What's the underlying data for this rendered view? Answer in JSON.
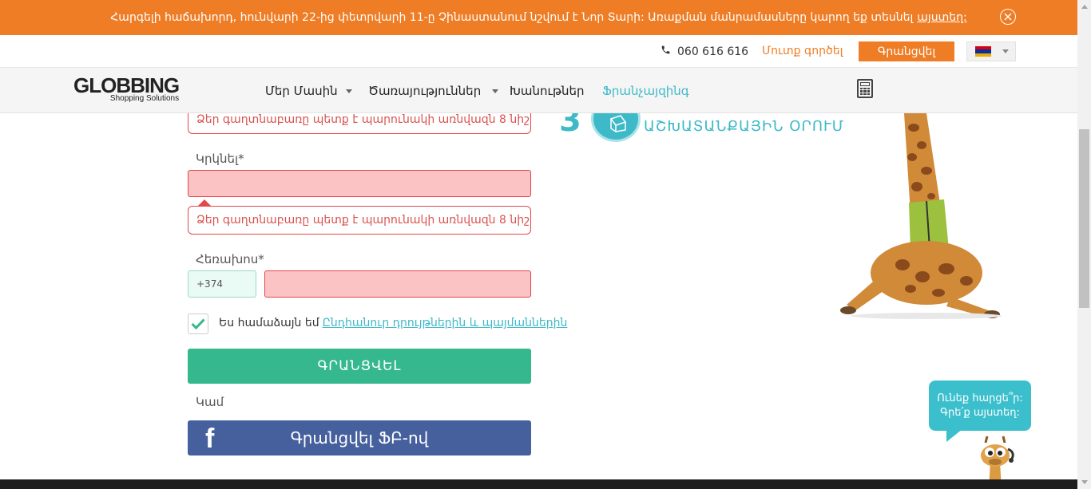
{
  "announcement": {
    "text": "Հարգելի հաճախորդ, հունվարի 22-ից փետրվարի 11-ը Չինաստանում նշվում է Նոր Տարի: Առաքման մանրամասները կարող եք տեսնել",
    "link": "այստեղ:"
  },
  "topbar": {
    "phone": "060 616 616",
    "login": "Մուտք գործել",
    "register": "Գրանցվել",
    "language_flag": [
      "#d90012",
      "#0033a0",
      "#f2a800"
    ]
  },
  "nav": {
    "logo_brand": "GLOBBING",
    "logo_sub": "Shopping Solutions",
    "items": [
      {
        "label": "Մեր Մասին",
        "has_dropdown": true
      },
      {
        "label": "Ծառայություններ",
        "has_dropdown": true
      },
      {
        "label": "Խանութներ",
        "has_dropdown": false
      },
      {
        "label": "Ֆրանչայզինգ",
        "has_dropdown": false,
        "active": true
      }
    ]
  },
  "form": {
    "password_error": "Ձեր գաղտնաբառը պետք է պարունակի առնվազն 8 նիշ",
    "repeat_label": "Կրկնել*",
    "repeat_error": "Ձեր գաղտնաբառը պետք է պարունակի առնվազն 8 նիշ",
    "phone_label": "Հեռախոս*",
    "phone_code": "+374",
    "agree_text": "Ես համաձայն եմ",
    "agree_link": "Ընդհանուր դրույթներին և պայմաններին",
    "agree_checked": true,
    "submit": "ԳՐԱՆՑՎԵԼ",
    "or": "Կամ",
    "facebook": "Գրանցվել ՖԲ-ով"
  },
  "promo": {
    "step_number": "3",
    "step_text": "ԱՇԽԱՏԱՆՔԱՅԻՆ ՕՐՈՒՄ"
  },
  "chat": {
    "line1": "Ունեք հարցե՞ր:",
    "line2": "Գրե՛ք այստեղ:"
  },
  "colors": {
    "brand_orange": "#ef7d26",
    "accent_teal": "#3db9c8",
    "submit_green": "#35b88e",
    "facebook_blue": "#46609d",
    "error_red": "#e2474c"
  }
}
